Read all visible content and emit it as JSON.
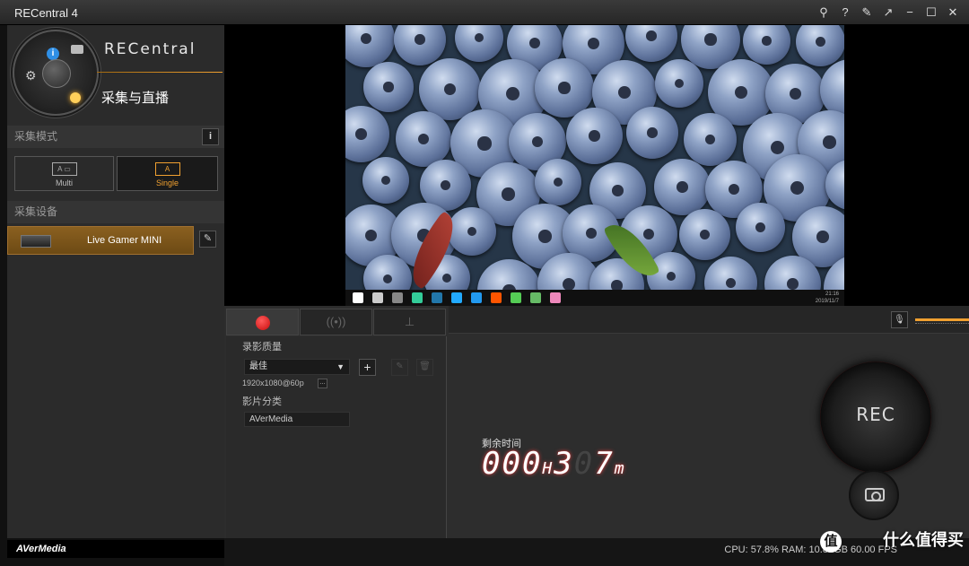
{
  "window": {
    "title": "RECentral 4",
    "buttons": [
      "pin",
      "help",
      "pin-window",
      "collapse",
      "minimize",
      "maximize",
      "close"
    ]
  },
  "brand": {
    "logo_text": "RECentral",
    "mode_title": "采集与直播",
    "bottom_logo": "AVerMedia"
  },
  "left": {
    "capture_mode_label": "采集模式",
    "capture_device_label": "采集设备",
    "mode_buttons": [
      {
        "label": "Multi",
        "active": false
      },
      {
        "label": "Single",
        "active": true
      }
    ],
    "device": {
      "name": "Live Gamer MINI"
    }
  },
  "preview": {
    "tray_time": "21:16",
    "tray_date": "2019/11/7"
  },
  "record": {
    "tabs": [
      "record",
      "stream",
      "network"
    ],
    "quality_label": "录影质量",
    "quality_value": "最佳",
    "resolution": "1920x1080@60p",
    "category_label": "影片分类",
    "category_value": "AVerMedia"
  },
  "timer": {
    "label": "剩余时间",
    "hours": "000",
    "hours_unit": "H",
    "minutes_lit": "3",
    "minutes_dim": "0",
    "minutes_last": "7",
    "minutes_unit": "m"
  },
  "levels": {
    "mic_level": 0.95,
    "speaker_level": 0.95
  },
  "buttons": {
    "rec_label": "REC"
  },
  "status": {
    "text": "CPU: 57.8%  RAM: 10.82GB  60.00 FPS"
  },
  "watermark": {
    "text": "什么值得买",
    "logo": "值"
  },
  "colors": {
    "accent": "#f0a030",
    "rec_red": "#d22222"
  }
}
